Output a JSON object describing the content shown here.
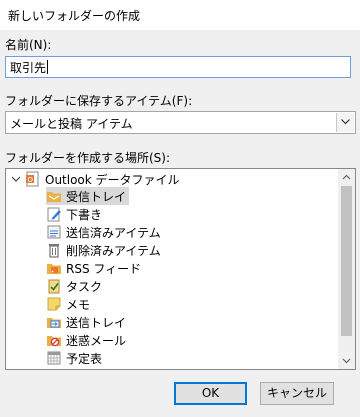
{
  "window": {
    "title": "新しいフォルダーの作成"
  },
  "name_field": {
    "label": "名前(N):",
    "value": "取引先"
  },
  "items_field": {
    "label": "フォルダーに保存するアイテム(F):",
    "selected": "メールと投稿 アイテム"
  },
  "location": {
    "label": "フォルダーを作成する場所(S):",
    "root": {
      "label": "Outlook データファイル",
      "icon": "outlook-data-file-icon",
      "expanded": true
    },
    "items": [
      {
        "label": "受信トレイ",
        "icon": "inbox-icon",
        "selected": true
      },
      {
        "label": "下書き",
        "icon": "drafts-icon"
      },
      {
        "label": "送信済みアイテム",
        "icon": "sent-items-icon"
      },
      {
        "label": "削除済みアイテム",
        "icon": "deleted-items-icon"
      },
      {
        "label": "RSS フィード",
        "icon": "rss-icon"
      },
      {
        "label": "タスク",
        "icon": "tasks-icon"
      },
      {
        "label": "メモ",
        "icon": "notes-icon"
      },
      {
        "label": "送信トレイ",
        "icon": "outbox-icon"
      },
      {
        "label": "迷惑メール",
        "icon": "junk-email-icon"
      },
      {
        "label": "予定表",
        "icon": "calendar-icon"
      }
    ]
  },
  "buttons": {
    "ok": "OK",
    "cancel": "キャンセル"
  },
  "colors": {
    "selection": "#d9d9d9",
    "focus_border": "#6e9ce0",
    "ok_border": "#0078d7",
    "folder": "#e8b045"
  }
}
